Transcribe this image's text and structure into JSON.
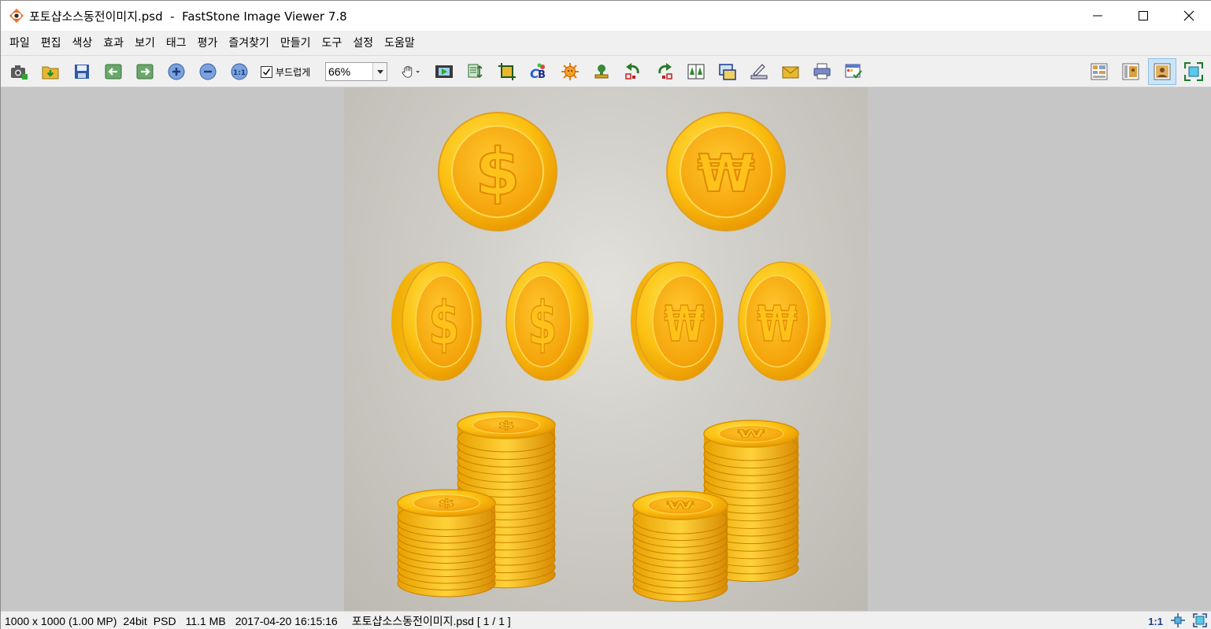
{
  "window": {
    "title": "포토샵소스동전이미지.psd  -  FastStone Image Viewer 7.8"
  },
  "menu": [
    "파일",
    "편집",
    "색상",
    "효과",
    "보기",
    "태그",
    "평가",
    "즐겨찾기",
    "만들기",
    "도구",
    "설정",
    "도움말"
  ],
  "toolbar": {
    "smooth_label": "부드럽게",
    "smooth_checked": true,
    "zoom_value": "66%"
  },
  "image": {
    "description_icons": [
      "dollar-coin",
      "won-coin"
    ]
  },
  "status": {
    "dimensions": "1000 x 1000 (1.00 MP)",
    "bitdepth": "24bit",
    "format": "PSD",
    "filesize": "11.1 MB",
    "datetime": "2017-04-20 16:15:16",
    "filename": "포토샵소스동전이미지.psd [ 1 / 1 ]",
    "ratio": "1:1"
  }
}
